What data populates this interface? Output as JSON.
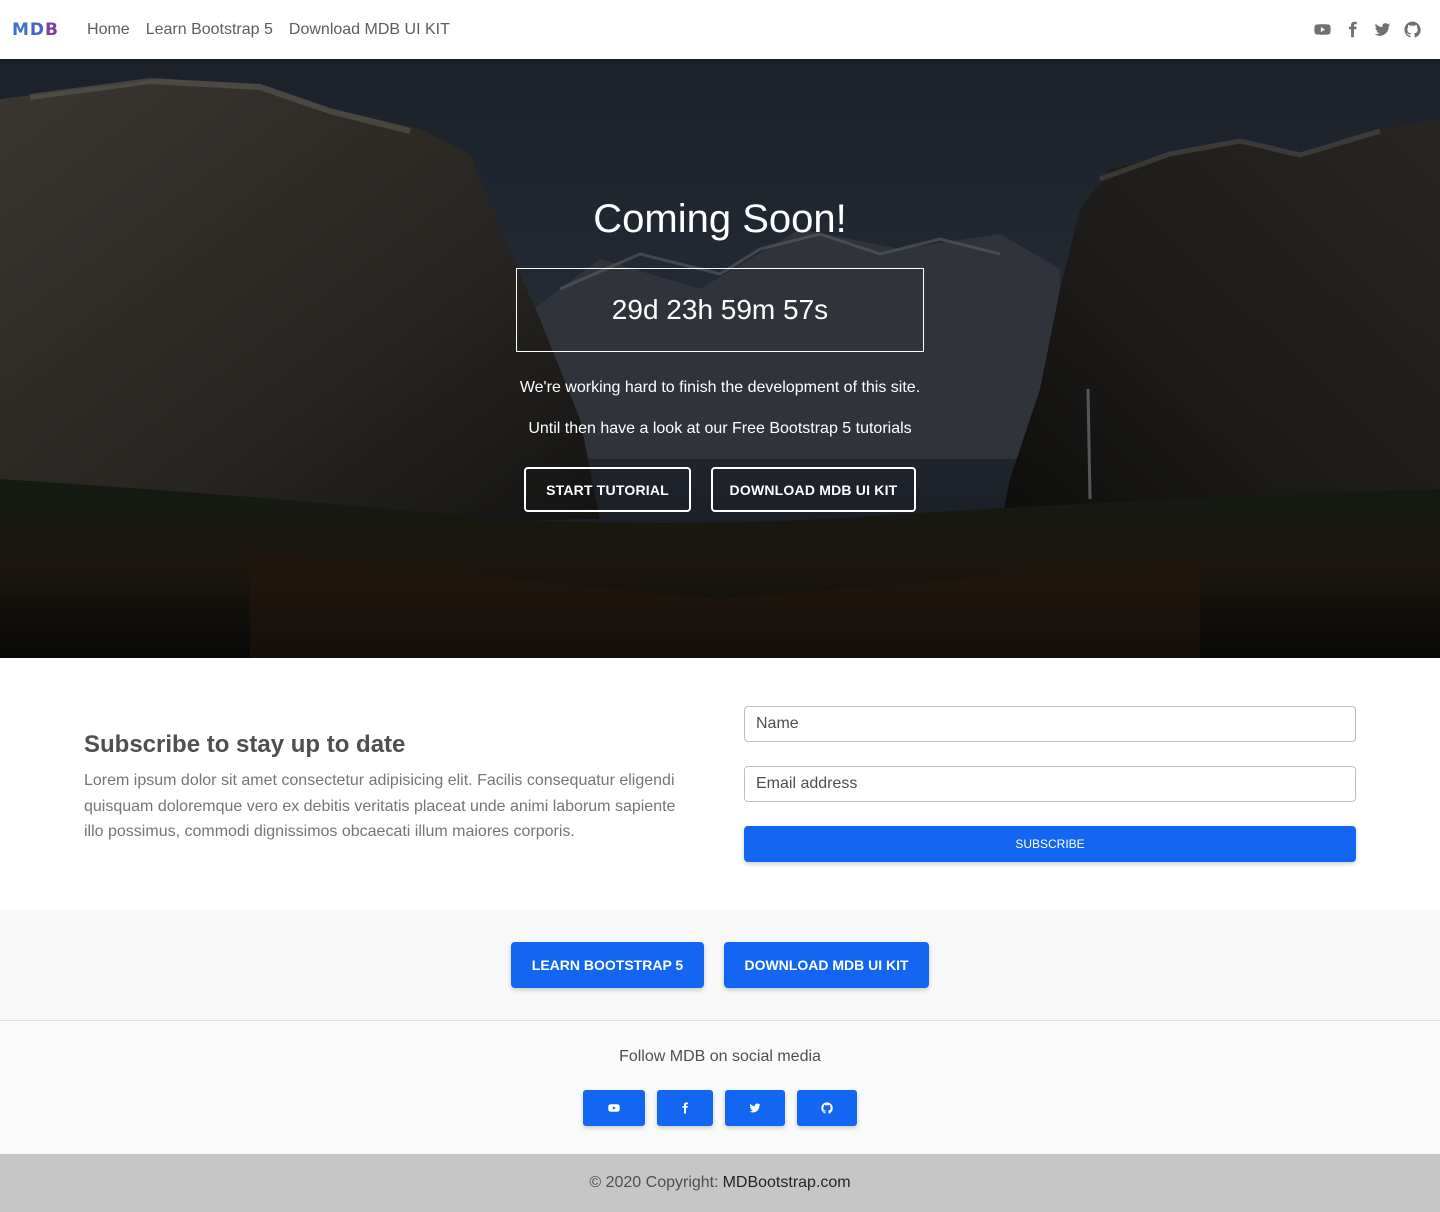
{
  "navbar": {
    "brand": [
      "M",
      "D",
      "B"
    ],
    "brand_colors": [
      "#3b71ca",
      "#4a5fc8",
      "#7b3fa8"
    ],
    "links": [
      "Home",
      "Learn Bootstrap 5",
      "Download MDB UI KIT"
    ],
    "icons": [
      "youtube-icon",
      "facebook-icon",
      "twitter-icon",
      "github-icon"
    ]
  },
  "hero": {
    "title": "Coming Soon!",
    "countdown": "29d 23h 59m 57s",
    "text1": "We're working hard to finish the development of this site.",
    "text2": "Until then have a look at our Free Bootstrap 5 tutorials",
    "buttons": [
      "START TUTORIAL",
      "DOWNLOAD MDB UI KIT"
    ]
  },
  "subscribe": {
    "heading": "Subscribe to stay up to date",
    "text": "Lorem ipsum dolor sit amet consectetur adipisicing elit. Facilis consequatur eligendi quisquam doloremque vero ex debitis veritatis placeat unde animi laborum sapiente illo possimus, commodi dignissimos obcaecati illum maiores corporis.",
    "name_placeholder": "Name",
    "email_placeholder": "Email address",
    "button": "SUBSCRIBE"
  },
  "cta": {
    "buttons": [
      "LEARN BOOTSTRAP 5",
      "DOWNLOAD MDB UI KIT"
    ]
  },
  "footer": {
    "follow": "Follow MDB on social media",
    "social_icons": [
      "youtube-icon",
      "facebook-icon",
      "twitter-icon",
      "github-icon"
    ],
    "copyright_prefix": "© 2020 Copyright:",
    "copyright_link": "MDBootstrap.com"
  },
  "colors": {
    "primary": "#1266f1",
    "copyright_bg": "#c6c6c6"
  }
}
